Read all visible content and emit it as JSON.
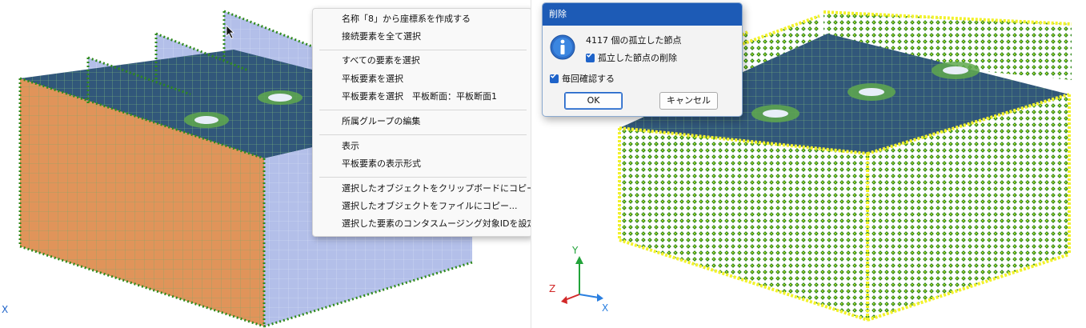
{
  "context_menu": {
    "items": [
      "名称「8」から座標系を作成する",
      "接続要素を全て選択",
      "すべての要素を選択",
      "平板要素を選択",
      "平板要素を選択　平板断面：平板断面1",
      "所属グループの編集",
      "表示",
      "平板要素の表示形式",
      "選択したオブジェクトをクリップボードにコピー",
      "選択したオブジェクトをファイルにコピー...",
      "選択した要素のコンタスムージング対象IDを設定"
    ]
  },
  "dialog": {
    "title": "削除",
    "message": "4117 個の孤立した節点",
    "checkbox_delete": "孤立した節点の削除",
    "checkbox_confirm": "毎回確認する",
    "ok_label": "OK",
    "cancel_label": "キャンセル"
  },
  "axes": {
    "left_x": "X",
    "y": "Y",
    "z": "Z",
    "x": "X"
  },
  "colors": {
    "front_face": "#e0945a",
    "side_face": "#b3bfe9",
    "top_face": "#31577a",
    "mesh_line": "#a7d392",
    "node": "#2f8a1c",
    "yellow_node": "#f2f22a",
    "dialog_title": "#1d5bb6"
  }
}
